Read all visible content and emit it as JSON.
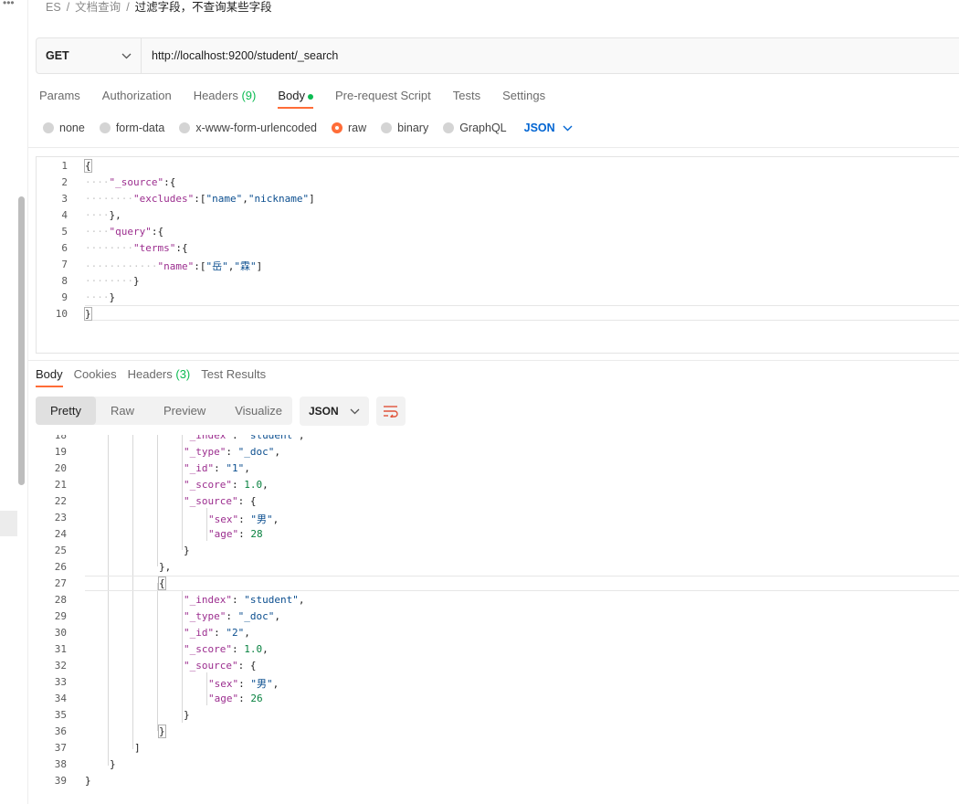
{
  "breadcrumb": {
    "root": "ES",
    "sep": "/",
    "folder": "文档查询",
    "current": "过滤字段，不查询某些字段"
  },
  "request": {
    "method": "GET",
    "url": "http://localhost:9200/student/_search"
  },
  "req_tabs": [
    {
      "label": "Params"
    },
    {
      "label": "Authorization"
    },
    {
      "label": "Headers",
      "count": "(9)"
    },
    {
      "label": "Body",
      "active": true
    },
    {
      "label": "Pre-request Script"
    },
    {
      "label": "Tests"
    },
    {
      "label": "Settings"
    }
  ],
  "body_types": [
    "none",
    "form-data",
    "x-www-form-urlencoded",
    "raw",
    "binary",
    "GraphQL"
  ],
  "body_type_selected": "raw",
  "body_format": "JSON",
  "request_lines": [
    "1",
    "2",
    "3",
    "4",
    "5",
    "6",
    "7",
    "8",
    "9",
    "10"
  ],
  "response_tabs": [
    {
      "label": "Body",
      "active": true
    },
    {
      "label": "Cookies"
    },
    {
      "label": "Headers",
      "count": "(3)"
    },
    {
      "label": "Test Results"
    }
  ],
  "view_modes": [
    "Pretty",
    "Raw",
    "Preview",
    "Visualize"
  ],
  "view_selected": "Pretty",
  "response_format": "JSON",
  "response_lines": [
    "18",
    "19",
    "20",
    "21",
    "22",
    "23",
    "24",
    "25",
    "26",
    "27",
    "28",
    "29",
    "30",
    "31",
    "32",
    "33",
    "34",
    "35",
    "36",
    "37",
    "38",
    "39"
  ],
  "colors": {
    "accent": "#ff6c37",
    "count_green": "#0cbb52",
    "json_blue": "#0265d2"
  }
}
